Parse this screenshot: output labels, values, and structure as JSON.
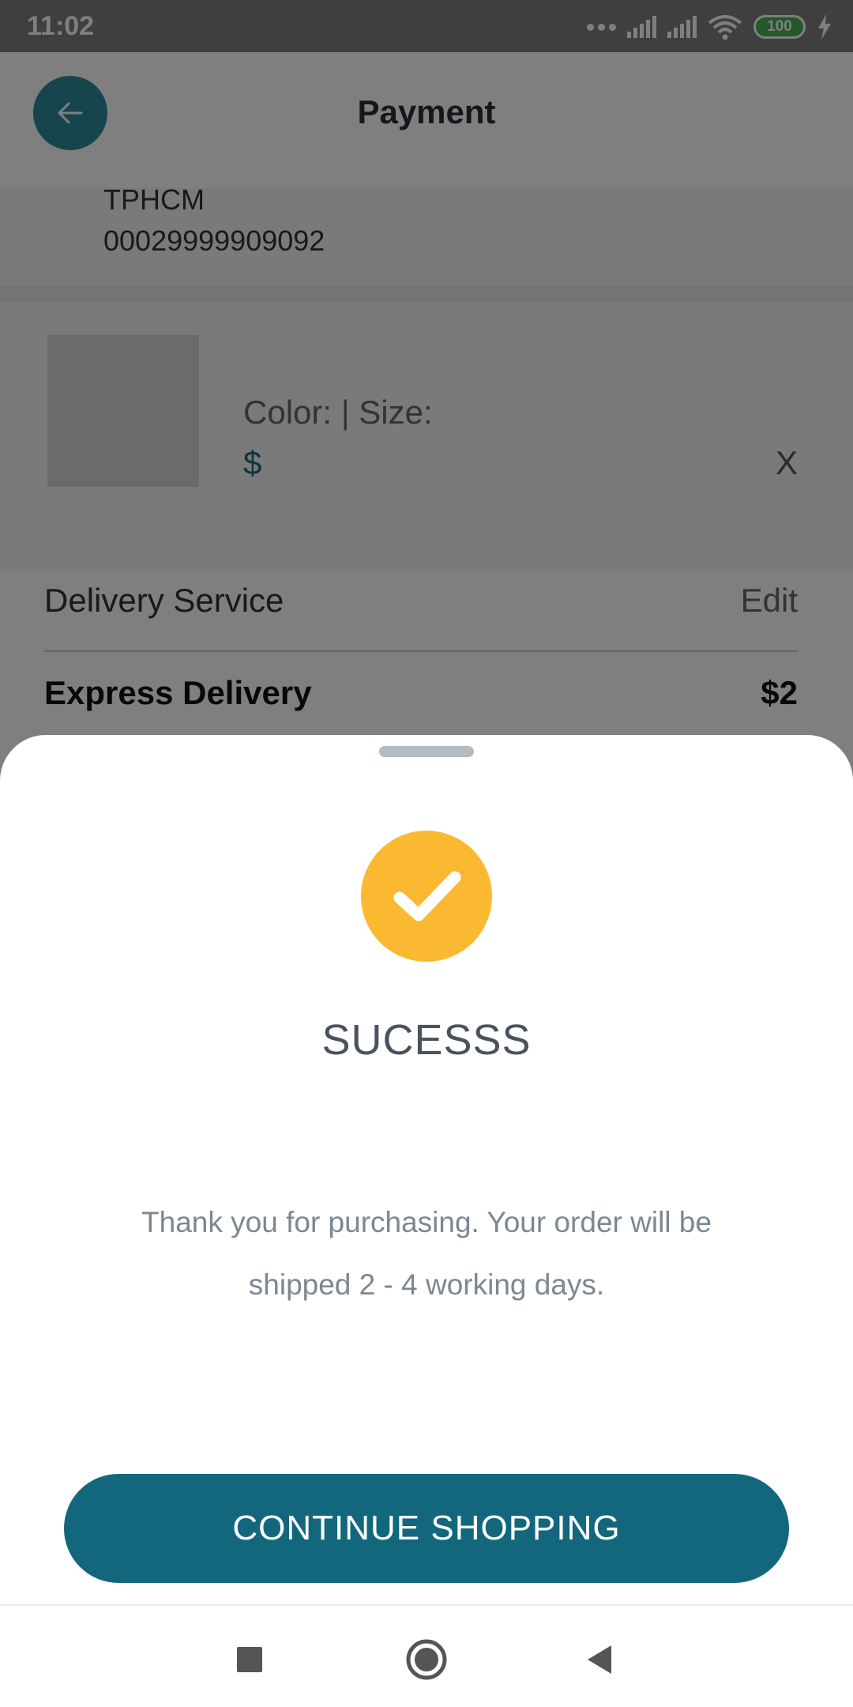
{
  "status_bar": {
    "time": "11:02",
    "battery": "100"
  },
  "appbar": {
    "title": "Payment",
    "back_icon": "arrow-left-icon"
  },
  "address": {
    "line1": "TPHCM",
    "line2": "00029999909092"
  },
  "product": {
    "attributes": "Color:  | Size:",
    "price": "$",
    "remove": "X"
  },
  "delivery": {
    "label": "Delivery Service",
    "edit": "Edit",
    "option_name": "Express Delivery",
    "option_price": "$2"
  },
  "dialog": {
    "icon": "check-circle-icon",
    "title": "SUCESSS",
    "message": "Thank you for purchasing. Your order will be shipped 2 - 4 working days.",
    "button": "CONTINUE SHOPPING"
  },
  "colors": {
    "accent": "#12677d",
    "success": "#fbb932",
    "title_text": "#4a5260",
    "message_text": "#7a8893"
  },
  "navbar": {
    "icons": [
      "recents-square-icon",
      "home-circle-icon",
      "back-triangle-icon"
    ]
  }
}
